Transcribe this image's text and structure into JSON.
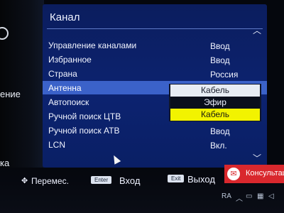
{
  "left_menu_partial": [
    "ение",
    "ка"
  ],
  "header": {
    "title": "Канал"
  },
  "menu": [
    {
      "label": "Управление каналами",
      "value": "Ввод"
    },
    {
      "label": "Избранное",
      "value": "Ввод"
    },
    {
      "label": "Страна",
      "value": "Россия"
    },
    {
      "label": "Антенна",
      "value": "",
      "selected": true
    },
    {
      "label": "Автопоиск",
      "value": ""
    },
    {
      "label": "Ручной поиск ЦТВ",
      "value": ""
    },
    {
      "label": "Ручной поиск АТВ",
      "value": "Ввод"
    },
    {
      "label": "LCN",
      "value": "Вкл."
    }
  ],
  "dropdown": {
    "options": [
      "Кабель",
      "Эфир",
      "Кабель"
    ],
    "selected_index": 0,
    "highlighted_index": 2
  },
  "footer": {
    "move_hint": "Перемес.",
    "enter_key": "Enter",
    "enter_label": "Вход",
    "exit_key": "Exit",
    "exit_label": "Выход"
  },
  "notification": {
    "label": "Консультации"
  },
  "tray": {
    "letters": "RA"
  },
  "colors": {
    "panel": "#0c2370",
    "selected_row": "#3b62c9",
    "highlight_option": "#f2f300",
    "notification": "#d9282d"
  },
  "icons": {
    "move": "four-way-arrows-icon",
    "notification": "mail-icon",
    "up": "chevron-up-icon",
    "down": "chevron-down-icon",
    "cursor": "mouse-pointer-icon"
  }
}
